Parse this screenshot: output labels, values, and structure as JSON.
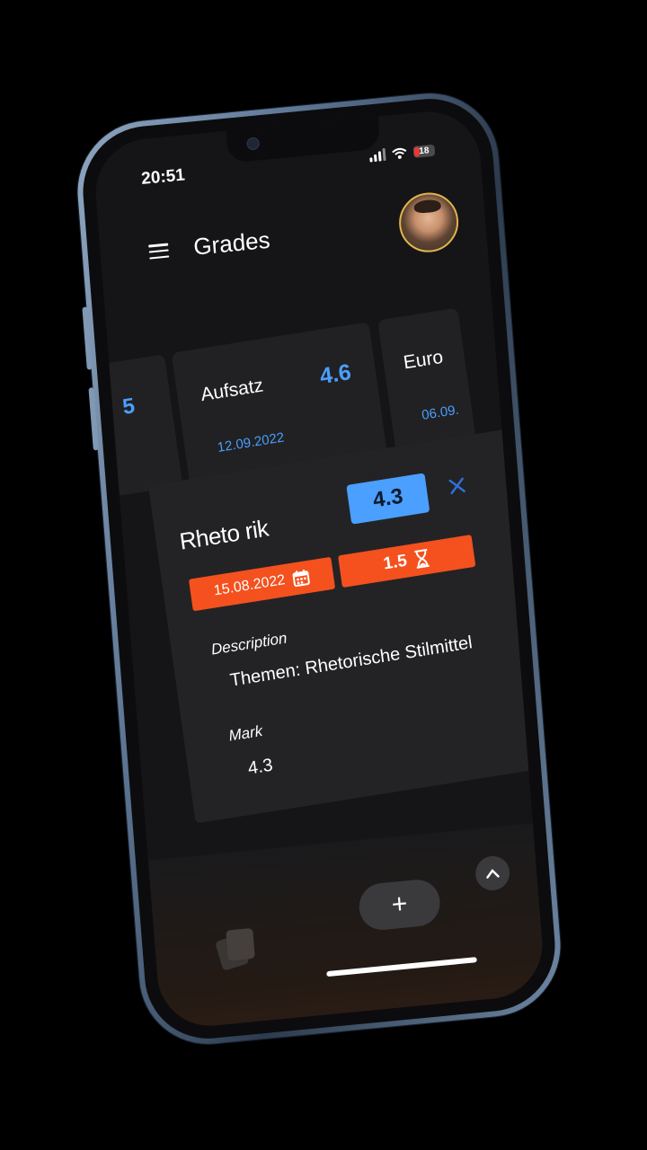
{
  "status_bar": {
    "time": "20:51",
    "battery_level": "18",
    "icons": [
      "cellular-signal-icon",
      "wifi-icon",
      "battery-icon"
    ]
  },
  "app_bar": {
    "title": "Grades",
    "menu_icon": "hamburger-menu-icon"
  },
  "grade_cards": [
    {
      "value": "5"
    },
    {
      "title": "Aufsatz",
      "value": "4.6",
      "date": "12.09.2022"
    },
    {
      "title": "Euro",
      "date": "06.09."
    }
  ],
  "detail": {
    "subject": "Rheto rik",
    "mark_badge": "4.3",
    "close_icon": "close-icon",
    "date_chip": "15.08.2022",
    "weight_chip": "1.5",
    "description_label": "Description",
    "description_value": "Themen: Rhetorische Stilmittel",
    "mark_label": "Mark",
    "mark_value": "4.3"
  },
  "bottom": {
    "add_label": "+",
    "up_icon": "chevron-up-icon"
  },
  "colors": {
    "accent_blue": "#4a9fff",
    "chip_orange": "#f4511e",
    "background": "#151517",
    "card": "#212123"
  }
}
